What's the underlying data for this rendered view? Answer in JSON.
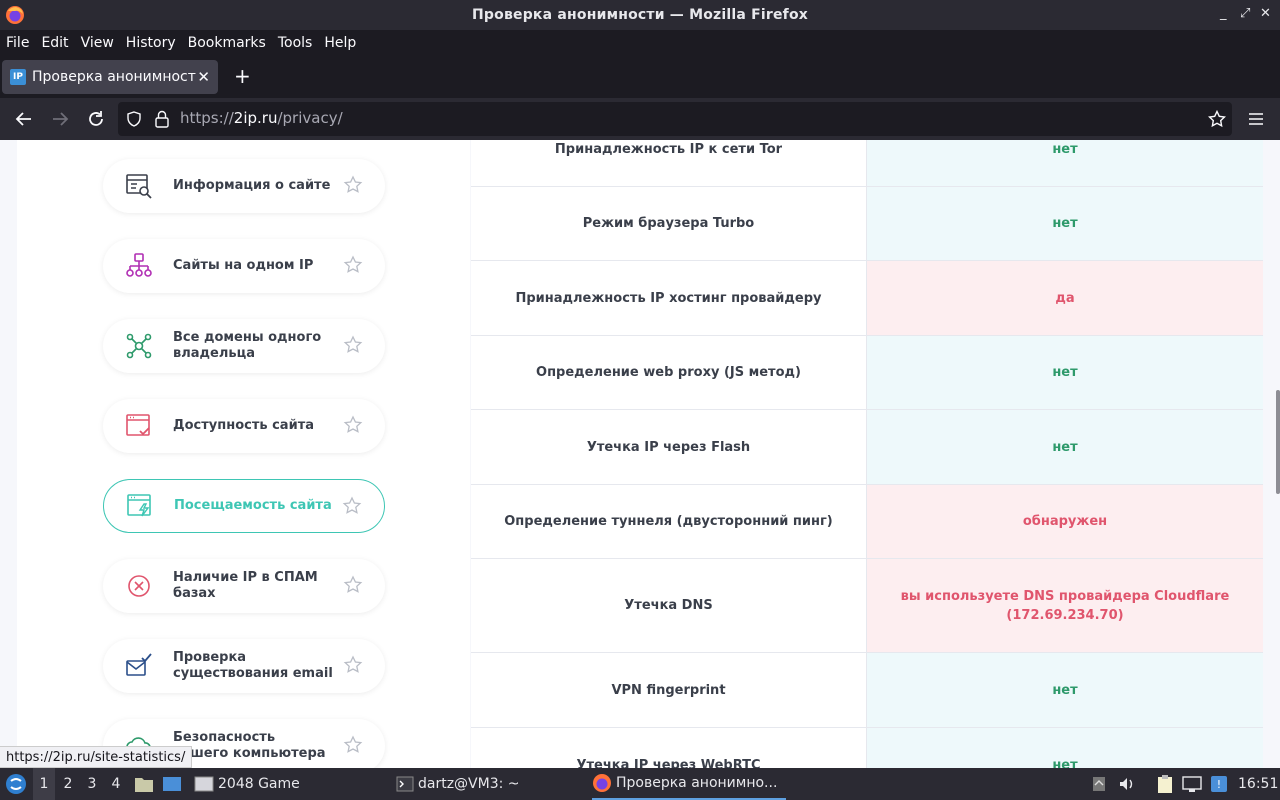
{
  "window": {
    "title": "Проверка анонимности — Mozilla Firefox"
  },
  "menu": [
    "File",
    "Edit",
    "View",
    "History",
    "Bookmarks",
    "Tools",
    "Help"
  ],
  "tab": {
    "favicon_text": "IP",
    "title": "Проверка анонимности"
  },
  "url": {
    "scheme": "https://",
    "host": "2ip.ru",
    "path": "/privacy/"
  },
  "sidebar": [
    {
      "label": "Информация о сайте",
      "icon": "site-info-icon",
      "color": "#3a3f4a"
    },
    {
      "label": "Сайты на одном IP",
      "icon": "network-tree-icon",
      "color": "#b12fb4"
    },
    {
      "label": "Все домены одного владельца",
      "icon": "domains-graph-icon",
      "color": "#2e9a6b"
    },
    {
      "label": "Доступность сайта",
      "icon": "availability-icon",
      "color": "#e0556d"
    },
    {
      "label": "Посещаемость сайта",
      "icon": "traffic-icon",
      "color": "#3ec6b4",
      "active": true
    },
    {
      "label": "Наличие IP в СПАМ базах",
      "icon": "spam-icon",
      "color": "#e0556d"
    },
    {
      "label": "Проверка существования email",
      "icon": "email-check-icon",
      "color": "#2b4f8a"
    },
    {
      "label": "Безопасность вашего компьютера",
      "icon": "security-cloud-icon",
      "color": "#2e9a6b"
    }
  ],
  "checks": [
    {
      "name": "Принадлежность IP к сети Tor",
      "value": "нет",
      "status": "ok"
    },
    {
      "name": "Режим браузера Turbo",
      "value": "нет",
      "status": "ok"
    },
    {
      "name": "Принадлежность IP хостинг провайдеру",
      "value": "да",
      "status": "bad"
    },
    {
      "name": "Определение web proxy (JS метод)",
      "value": "нет",
      "status": "ok"
    },
    {
      "name": "Утечка IP через Flash",
      "value": "нет",
      "status": "ok"
    },
    {
      "name": "Определение туннеля (двусторонний пинг)",
      "value": "обнаружен",
      "status": "bad"
    },
    {
      "name": "Утечка DNS",
      "value": "вы используете DNS провайдера Cloudflare (172.69.234.70)",
      "status": "bad"
    },
    {
      "name": "VPN fingerprint",
      "value": "нет",
      "status": "ok"
    },
    {
      "name": "Утечка IP через WebRTC",
      "value": "нет",
      "status": "ok"
    }
  ],
  "status_link": "https://2ip.ru/site-statistics/",
  "taskbar": {
    "workspaces": [
      "1",
      "2",
      "3",
      "4"
    ],
    "apps": [
      "2048 Game",
      "dartz@VM3: ~",
      "Проверка анонимно..."
    ],
    "clock": "16:51"
  }
}
